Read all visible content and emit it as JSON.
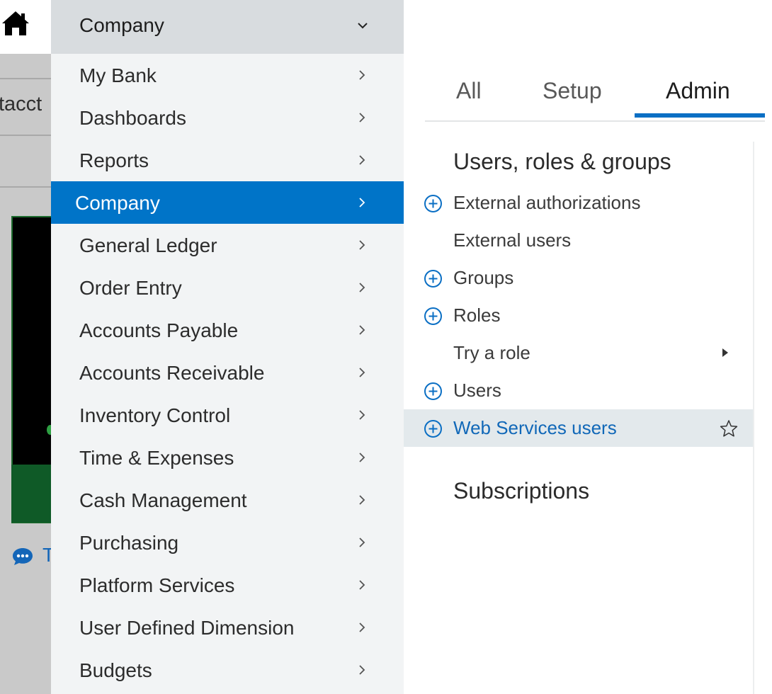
{
  "background": {
    "partial_text": "tacct",
    "chat_partial": "T"
  },
  "nav": {
    "header_label": "Company",
    "items": [
      {
        "label": "My Bank"
      },
      {
        "label": "Dashboards"
      },
      {
        "label": "Reports"
      },
      {
        "label": "Company",
        "active": true
      },
      {
        "label": "General Ledger"
      },
      {
        "label": "Order Entry"
      },
      {
        "label": "Accounts Payable"
      },
      {
        "label": "Accounts Receivable"
      },
      {
        "label": "Inventory Control"
      },
      {
        "label": "Time & Expenses"
      },
      {
        "label": "Cash Management"
      },
      {
        "label": "Purchasing"
      },
      {
        "label": "Platform Services"
      },
      {
        "label": "User Defined Dimension"
      },
      {
        "label": "Budgets"
      }
    ]
  },
  "flyout": {
    "tabs": [
      {
        "label": "All"
      },
      {
        "label": "Setup"
      },
      {
        "label": "Admin",
        "active": true
      }
    ],
    "sections": [
      {
        "title": "Users, roles & groups",
        "links": [
          {
            "label": "External authorizations",
            "plus": true
          },
          {
            "label": "External users",
            "plus": false
          },
          {
            "label": "Groups",
            "plus": true
          },
          {
            "label": "Roles",
            "plus": true
          },
          {
            "label": "Try a role",
            "plus": false,
            "submenu": true
          },
          {
            "label": "Users",
            "plus": true
          },
          {
            "label": "Web Services users",
            "plus": true,
            "highlighted": true,
            "favorite_icon": "star-outline"
          }
        ]
      },
      {
        "title": "Subscriptions",
        "links": []
      }
    ]
  },
  "colors": {
    "nav_active_bg": "#0074c8",
    "accent_blue": "#0b6fc4",
    "nav_bg": "#f2f4f5",
    "nav_header_bg": "#d8dcdf",
    "highlight_row_bg": "#e3e9ec"
  }
}
